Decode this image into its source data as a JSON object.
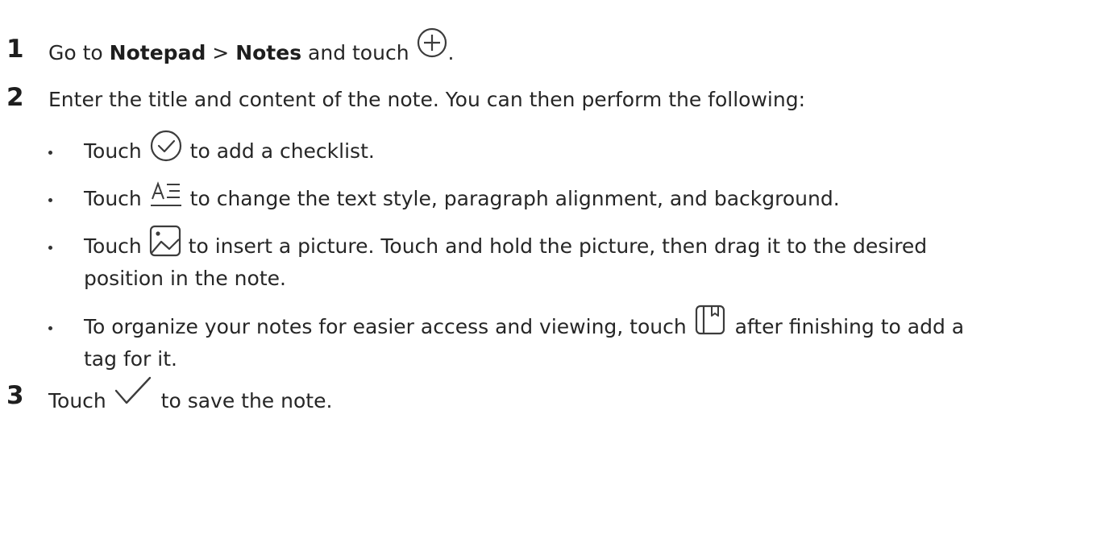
{
  "steps": [
    {
      "number": "1",
      "text_before": "Go to ",
      "bold_1": "Notepad",
      "separator": " > ",
      "bold_2": "Notes",
      "text_after_bold": " and touch ",
      "icon": "add-circle-icon",
      "text_end": "."
    },
    {
      "number": "2",
      "text": "Enter the title and content of the note. You can then perform the following:",
      "bullets": [
        {
          "before": "Touch ",
          "icon": "checklist-icon",
          "after": " to add a checklist."
        },
        {
          "before": "Touch ",
          "icon": "text-style-icon",
          "after": " to change the text style, paragraph alignment, and background."
        },
        {
          "before": "Touch ",
          "icon": "picture-icon",
          "after": " to insert a picture. Touch and hold the picture, then drag it to the desired",
          "after_line2": "position in the note."
        },
        {
          "before": "To organize your notes for easier access and viewing, touch ",
          "icon": "tag-icon",
          "after": " after finishing to add a",
          "after_line2": "tag for it."
        }
      ]
    },
    {
      "number": "3",
      "text_before": "Touch ",
      "icon": "checkmark-icon",
      "text_after": " to save the note."
    }
  ],
  "colors": {
    "text": "#262626",
    "icon_stroke": "#3c3c3c"
  }
}
